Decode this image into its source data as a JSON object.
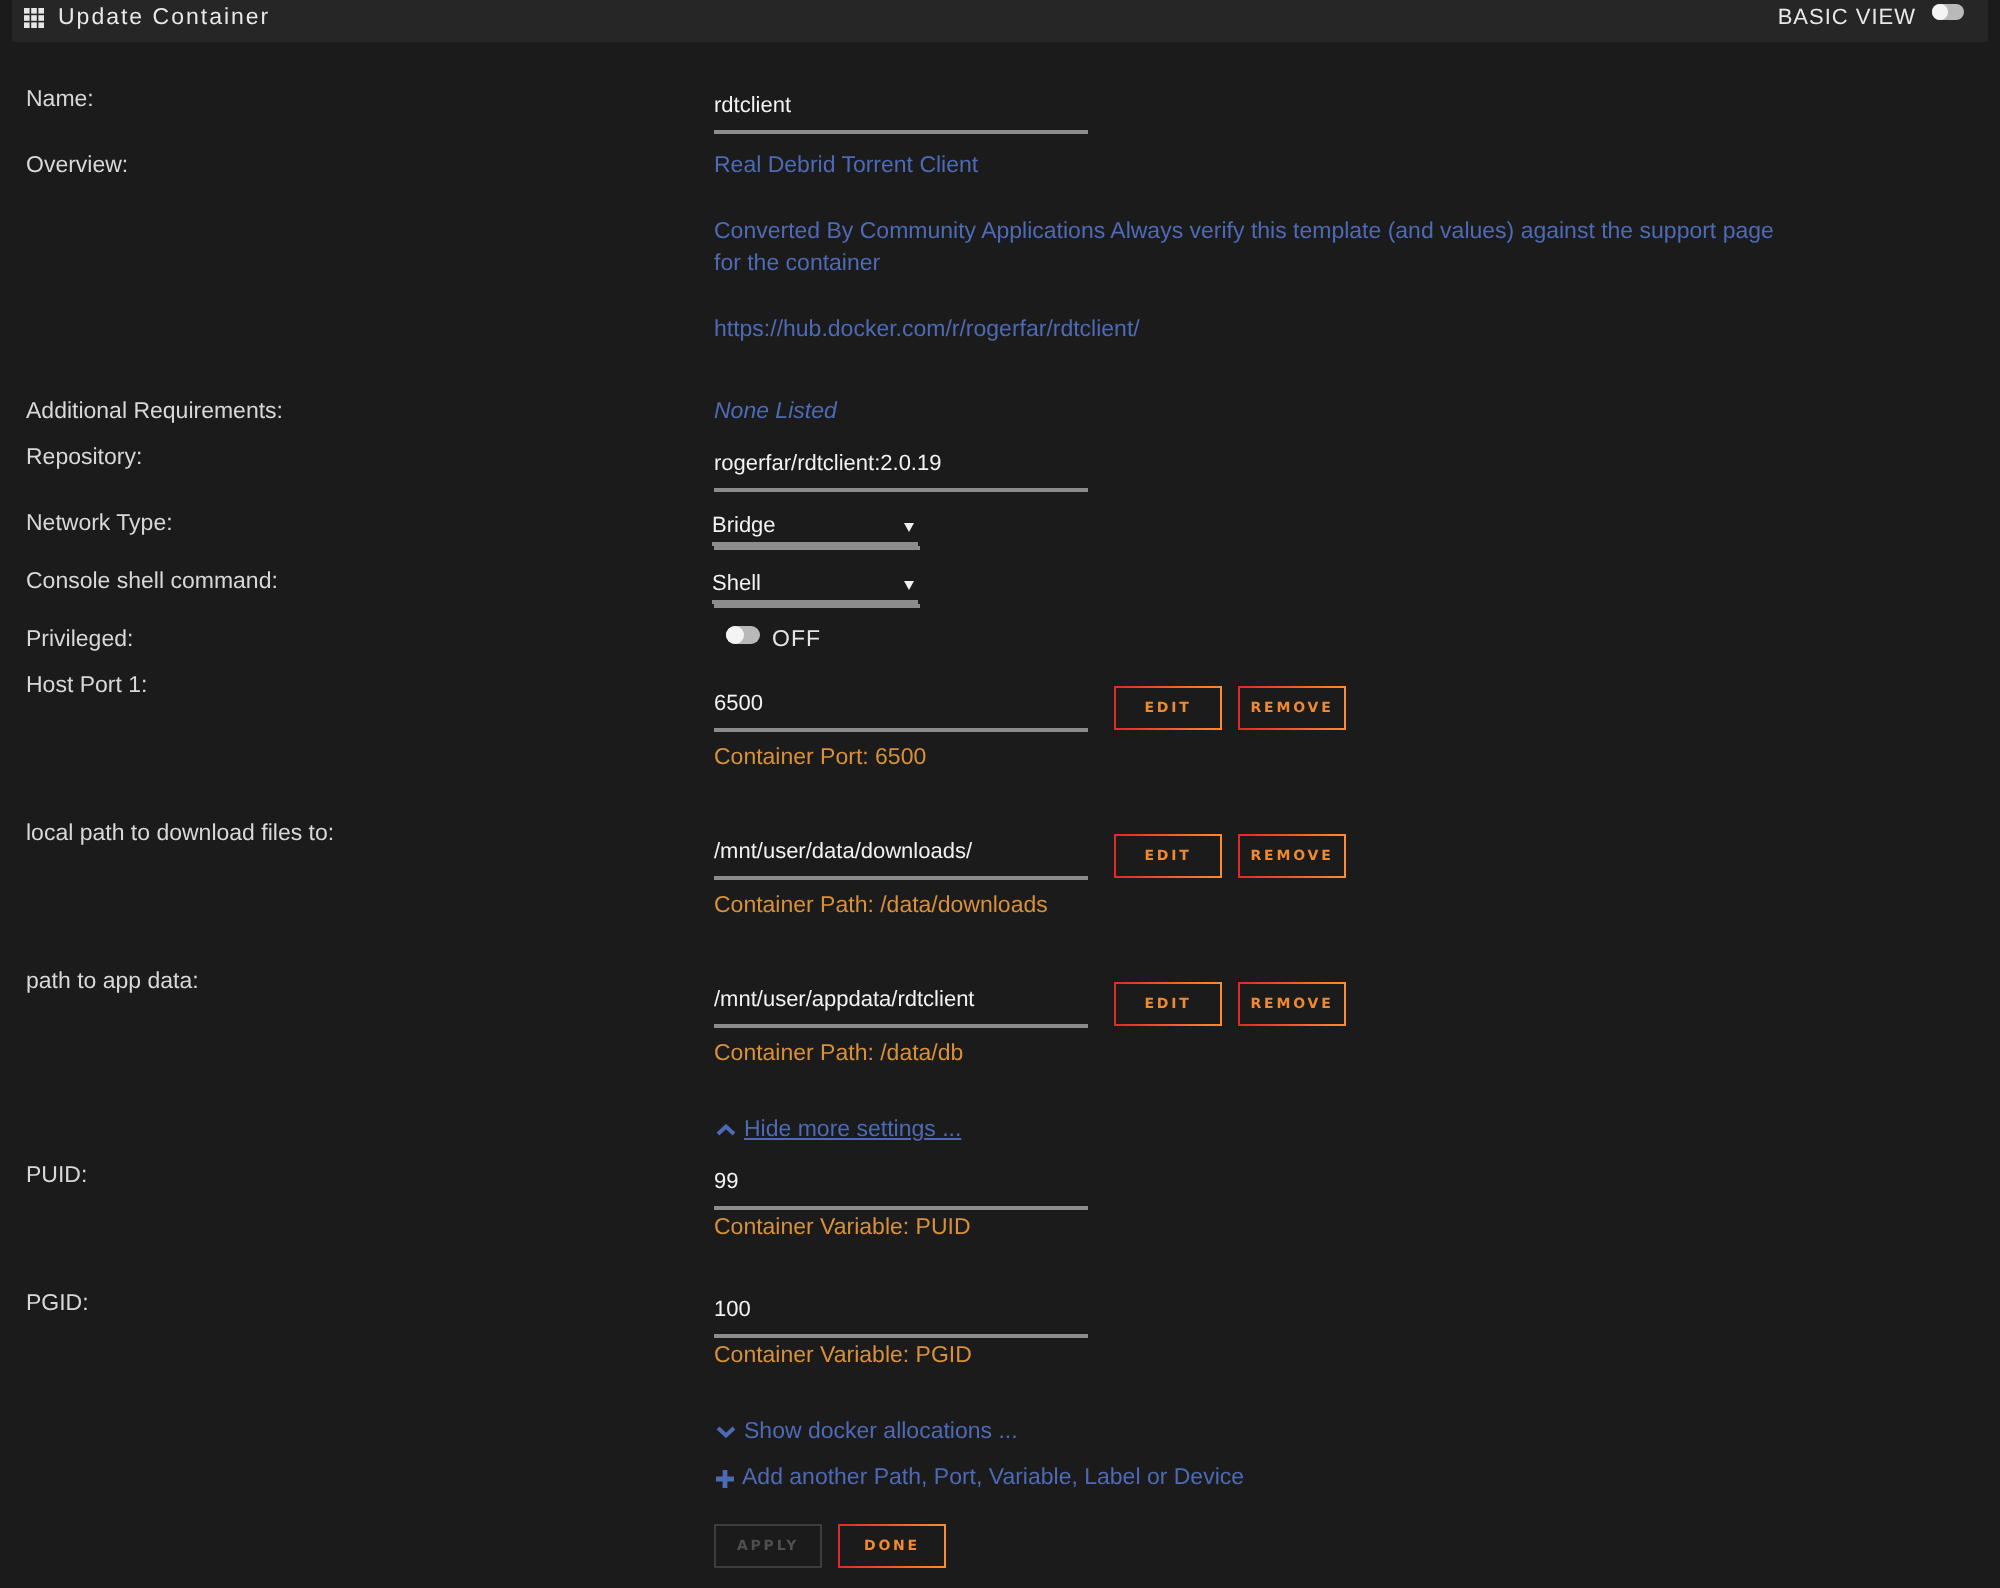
{
  "window": {
    "title": "Update Container",
    "view_switch": {
      "label": "BASIC VIEW",
      "on": false
    }
  },
  "fields": [
    {
      "kind": "input",
      "label": "Name:",
      "value": "rdtclient"
    },
    {
      "kind": "description",
      "label": "Overview:",
      "paragraphs": [
        "Real Debrid Torrent Client",
        "Converted By Community Applications Always verify this template (and values) against the support page for the container",
        "https://hub.docker.com/r/rogerfar/rdtclient/"
      ]
    },
    {
      "kind": "note",
      "label": "Additional Requirements:",
      "value": "None Listed"
    },
    {
      "kind": "input",
      "label": "Repository:",
      "value": "rogerfar/rdtclient:2.0.19"
    },
    {
      "kind": "select",
      "label": "Network Type:",
      "value": "Bridge"
    },
    {
      "kind": "select",
      "label": "Console shell command:",
      "value": "Shell"
    },
    {
      "kind": "switch",
      "label": "Privileged:",
      "on": false,
      "state_label": "OFF"
    },
    {
      "kind": "mapping",
      "label": "Host Port 1:",
      "value": "6500",
      "edit_button": "EDIT",
      "remove_button": "REMOVE",
      "target": "Container Port: 6500"
    },
    {
      "kind": "mapping",
      "label": "local path to download files to:",
      "value": "/mnt/user/data/downloads/",
      "edit_button": "EDIT",
      "remove_button": "REMOVE",
      "target": "Container Path: /data/downloads"
    },
    {
      "kind": "mapping",
      "label": "path to app data:",
      "value": "/mnt/user/appdata/rdtclient",
      "edit_button": "EDIT",
      "remove_button": "REMOVE",
      "target": "Container Path: /data/db"
    }
  ],
  "more_settings": {
    "label": "Hide more settings ...",
    "expanded": true,
    "hovered": true
  },
  "more_fields": [
    {
      "kind": "variable",
      "label": "PUID:",
      "value": "99",
      "target": "Container Variable: PUID"
    },
    {
      "kind": "variable",
      "label": "PGID:",
      "value": "100",
      "target": "Container Variable: PGID"
    }
  ],
  "allocations": {
    "label": "Show docker allocations ...",
    "expanded": false,
    "hovered": false
  },
  "add_entry": {
    "label": "Add another Path, Port, Variable, Label or Device"
  },
  "apply_button": {
    "label": "APPLY",
    "disabled": true
  },
  "done_button": {
    "label": "DONE",
    "disabled": false
  }
}
